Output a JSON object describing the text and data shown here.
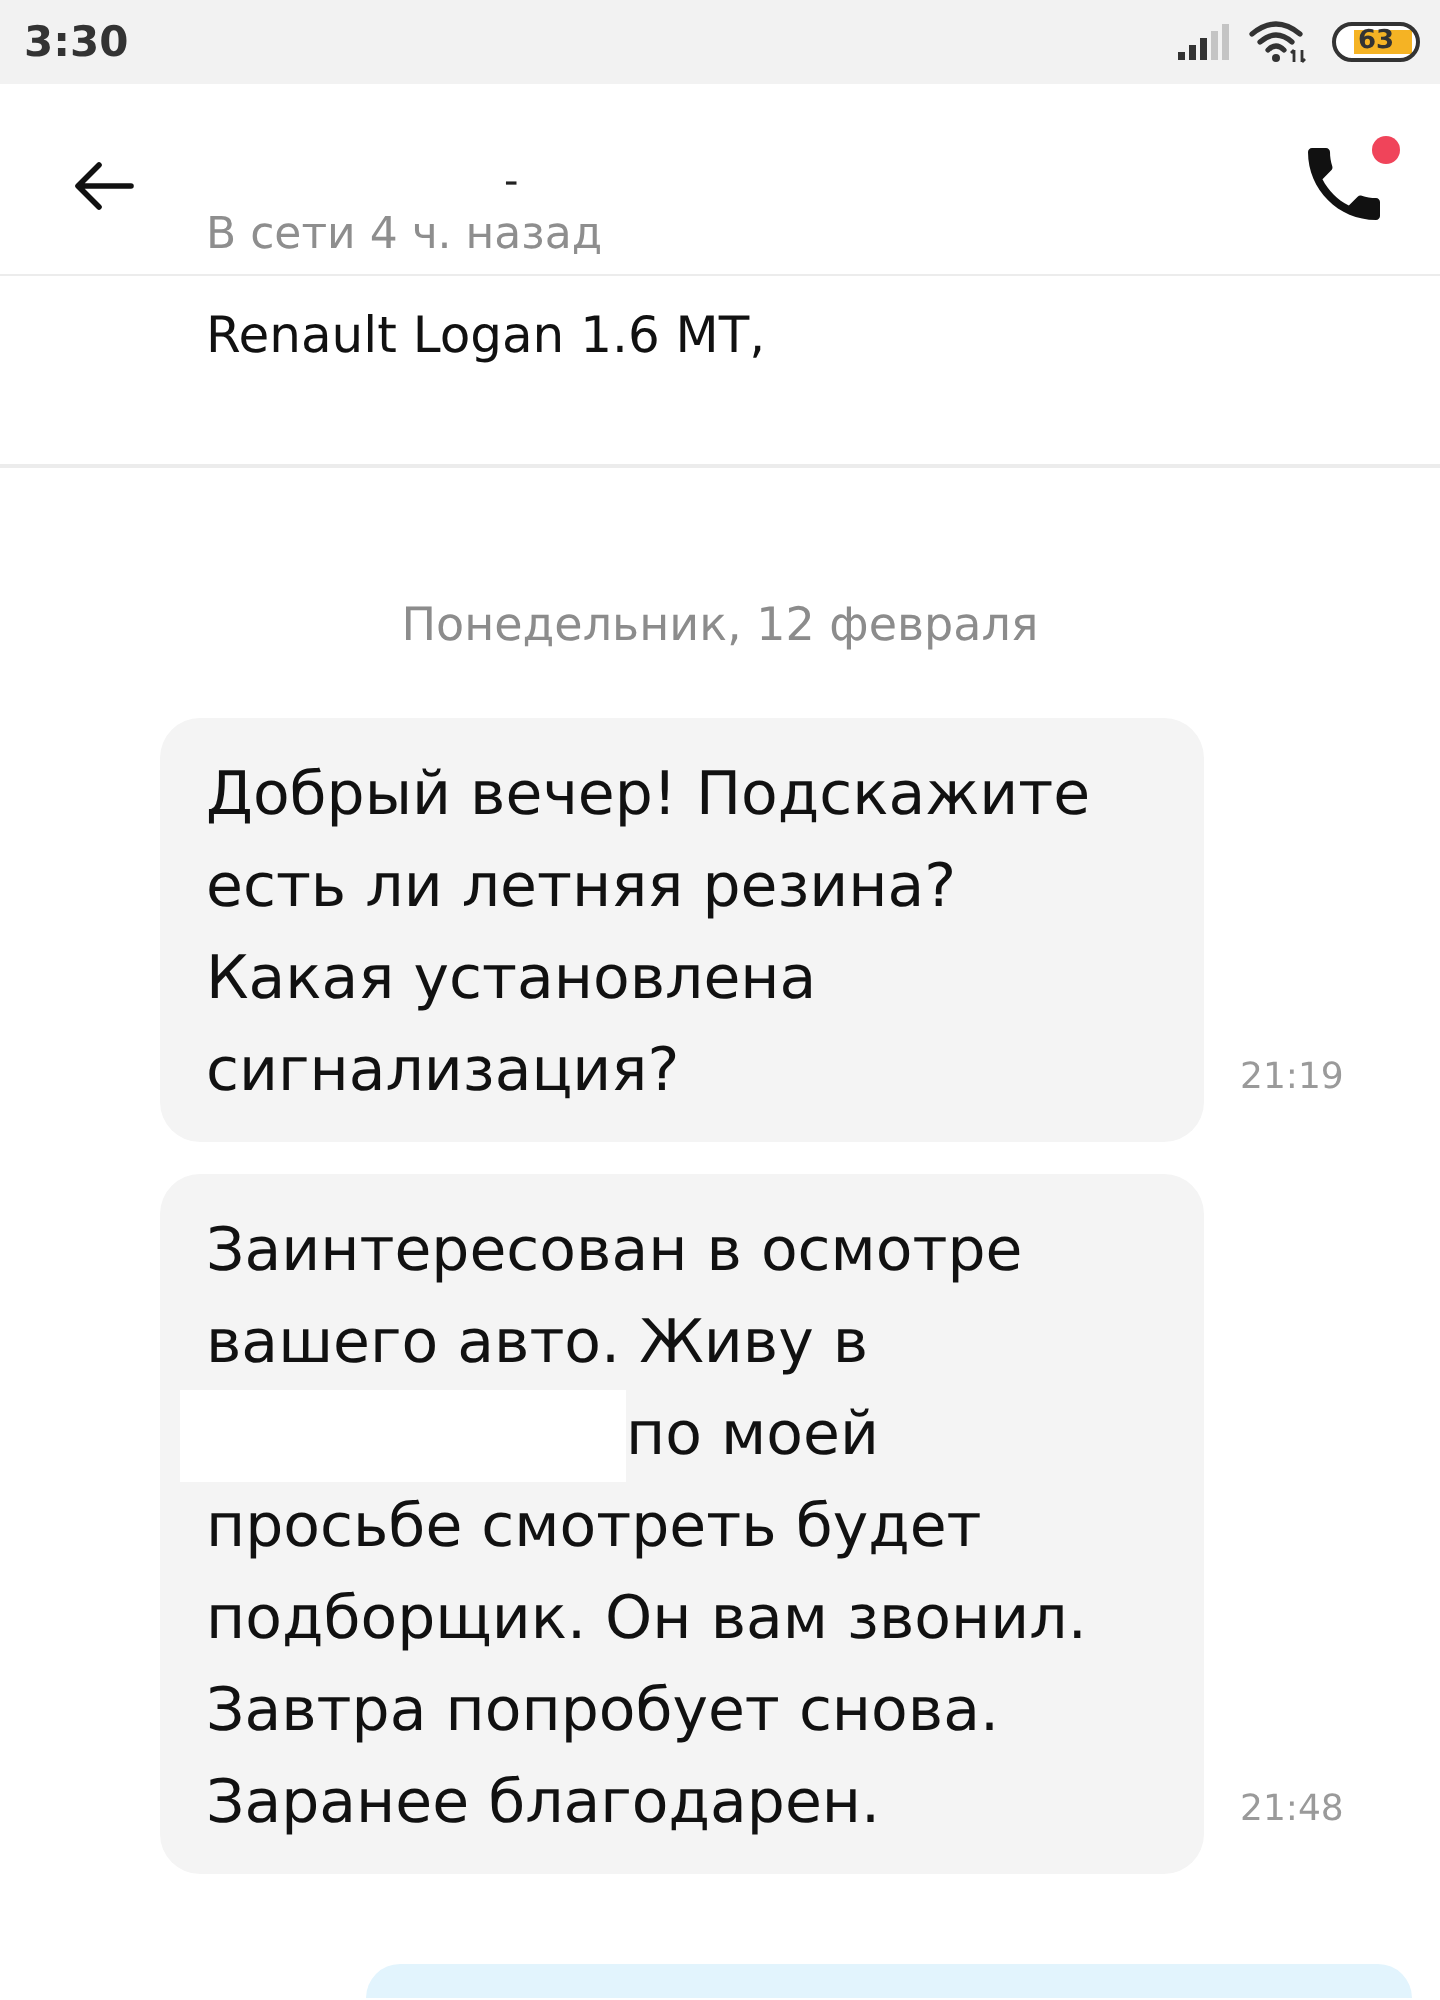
{
  "status_bar": {
    "time": "3:30",
    "battery": "63"
  },
  "header": {
    "title": "-",
    "subtitle": "В сети 4 ч. назад",
    "notification_dot": true
  },
  "listing": {
    "title": "Renault Logan 1.6 MT,"
  },
  "chat": {
    "date": "Понедельник, 12 февраля",
    "messages": [
      {
        "kind": "incoming",
        "parts": [
          {
            "kind": "text",
            "text": "Добрый вечер! Подскажите есть ли летняя резина? Какая установлена сигнализация?"
          }
        ],
        "time": "21:19"
      },
      {
        "kind": "incoming",
        "parts": [
          {
            "kind": "text",
            "text": "Заинтересован в осмотре вашего авто. Живу в"
          },
          {
            "kind": "redacted"
          },
          {
            "kind": "text",
            "text": "по моей"
          },
          {
            "kind": "text",
            "text": "просьбе смотреть будет подборщик. Он вам звонил. Завтра попробует снова. Заранее благодарен."
          }
        ],
        "time": "21:48"
      },
      {
        "kind": "outgoing"
      }
    ]
  }
}
